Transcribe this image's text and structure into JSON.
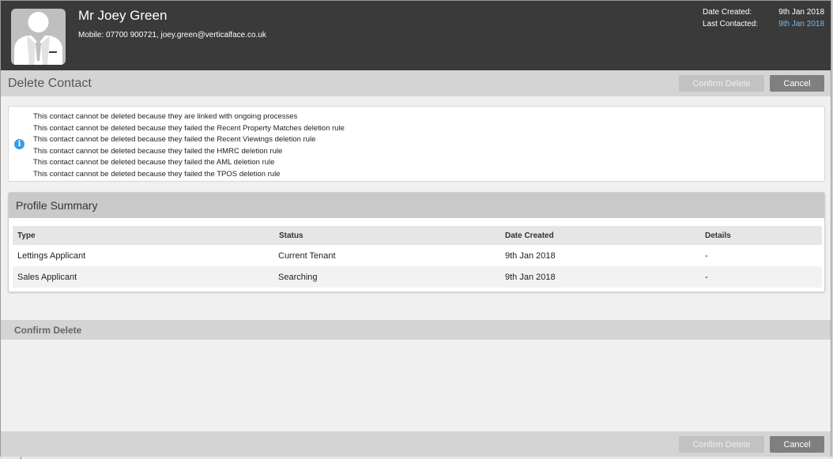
{
  "contact": {
    "name": "Mr Joey Green",
    "contact_line": "Mobile: 07700 900721, joey.green@verticalface.co.uk",
    "avatar_icon": "person-suit-icon"
  },
  "meta": {
    "date_created_label": "Date Created:",
    "date_created_value": "9th Jan 2018",
    "last_contacted_label": "Last Contacted:",
    "last_contacted_value": "9th Jan 2018"
  },
  "page": {
    "title": "Delete Contact",
    "confirm_delete_label": "Confirm Delete",
    "cancel_label": "Cancel"
  },
  "notice": {
    "icon": "info-icon",
    "lines": [
      "This contact cannot be deleted because they are linked with ongoing processes",
      "This contact cannot be deleted because they failed the Recent Property Matches deletion rule",
      "This contact cannot be deleted because they failed the Recent Viewings deletion rule",
      "This contact cannot be deleted because they failed the HMRC deletion rule",
      "This contact cannot be deleted because they failed the AML deletion rule",
      "This contact cannot be deleted because they failed the TPOS deletion rule"
    ]
  },
  "profile_summary": {
    "title": "Profile Summary",
    "columns": [
      "Type",
      "Status",
      "Date Created",
      "Details"
    ],
    "rows": [
      [
        "Lettings Applicant",
        "Current Tenant",
        "9th Jan 2018",
        "-"
      ],
      [
        "Sales Applicant",
        "Searching",
        "9th Jan 2018",
        "-"
      ]
    ]
  },
  "confirm_section": {
    "title": "Confirm Delete"
  },
  "footer": {
    "confirm_delete_label": "Confirm Delete",
    "cancel_label": "Cancel"
  },
  "colors": {
    "header_bg": "#3a3a3a",
    "link": "#7ab8e8",
    "info_icon": "#3b9be3",
    "cancel_button": "#7f7f7f",
    "disabled_button": "#c2c2c2"
  }
}
